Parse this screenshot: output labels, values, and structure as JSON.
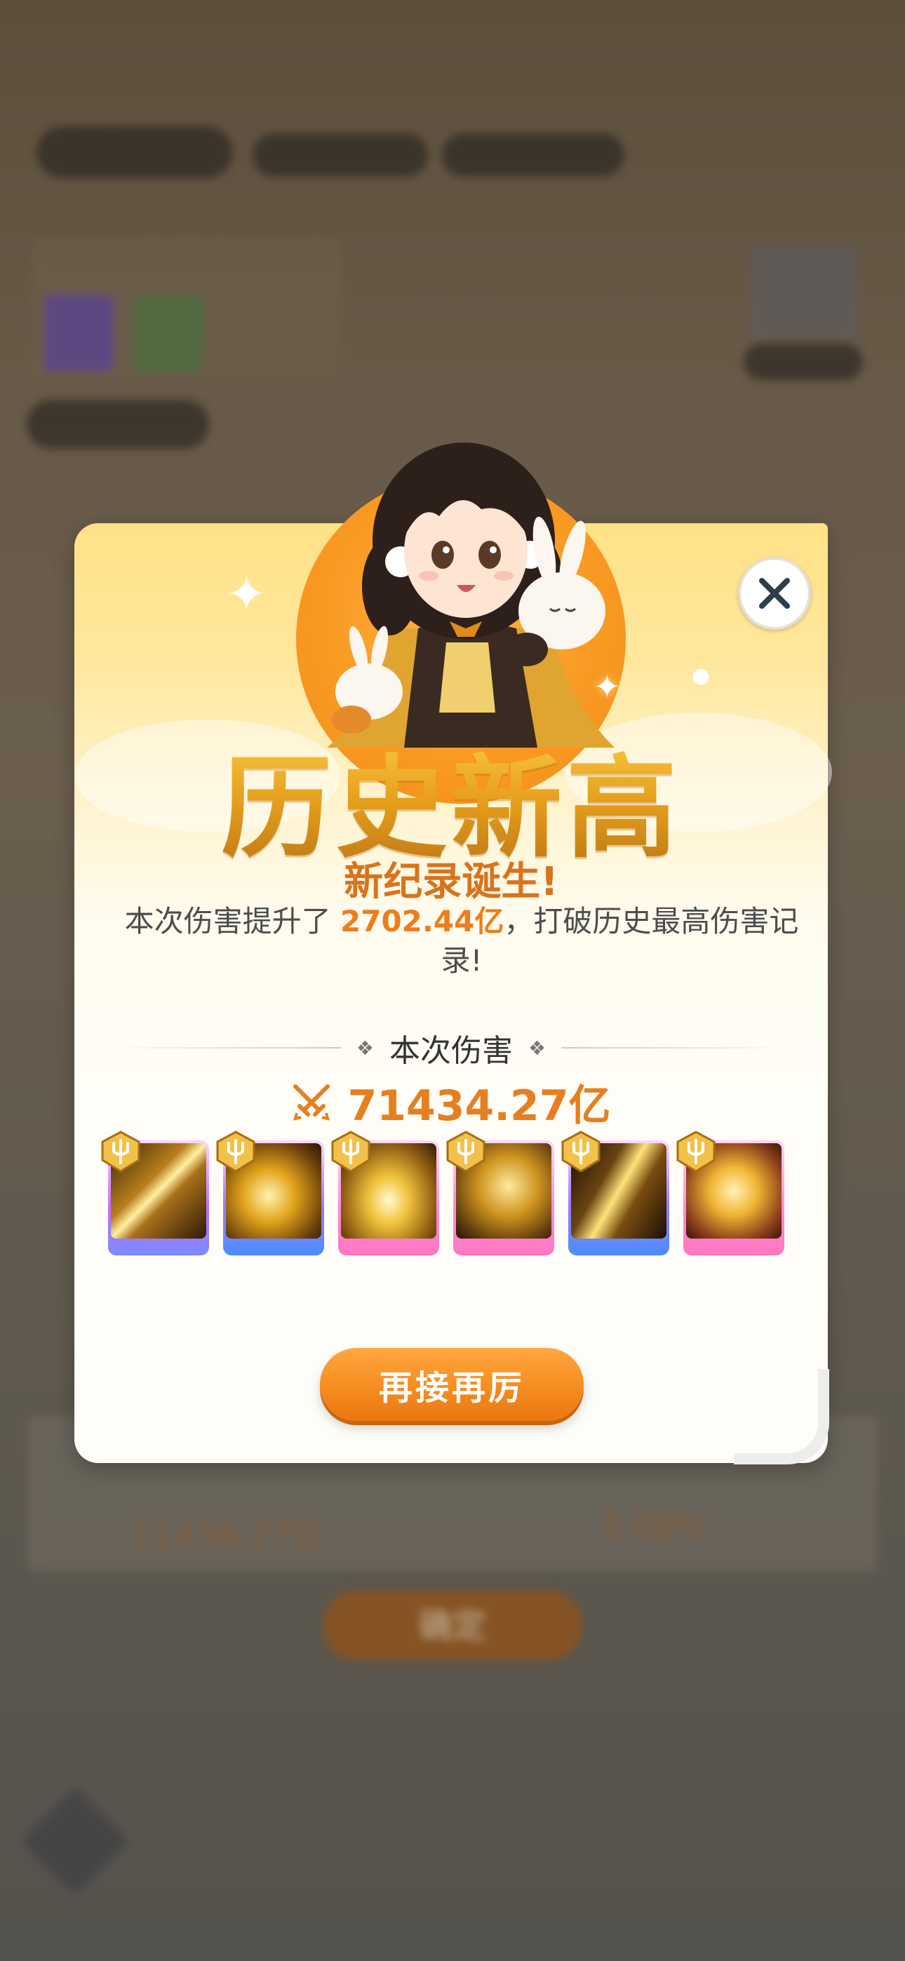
{
  "background": {
    "bottom_damage": "71434.27亿",
    "bottom_percent": "5.58%",
    "bottom_button": "确定"
  },
  "dialog": {
    "headline": "历史新高",
    "subhead": "新纪录诞生!",
    "desc_prefix": "本次伤害提升了 ",
    "desc_highlight": "2702.44亿",
    "desc_suffix": "，打破历史最高伤害记录!",
    "section_label": "本次伤害",
    "damage_value": "71434.27亿",
    "cta_label": "再接再厉",
    "skills": [
      {
        "name": "golden-swords",
        "frame": "purple"
      },
      {
        "name": "golden-phoenix",
        "frame": "blue"
      },
      {
        "name": "golden-radiance",
        "frame": "pink"
      },
      {
        "name": "golden-dragon",
        "frame": "pink"
      },
      {
        "name": "golden-lightning",
        "frame": "blue"
      },
      {
        "name": "golden-goddess",
        "frame": "pink"
      }
    ]
  },
  "colors": {
    "accent": "#ee7d1b",
    "headline_gold": "#e2a122",
    "cta": "#f48a1d"
  }
}
